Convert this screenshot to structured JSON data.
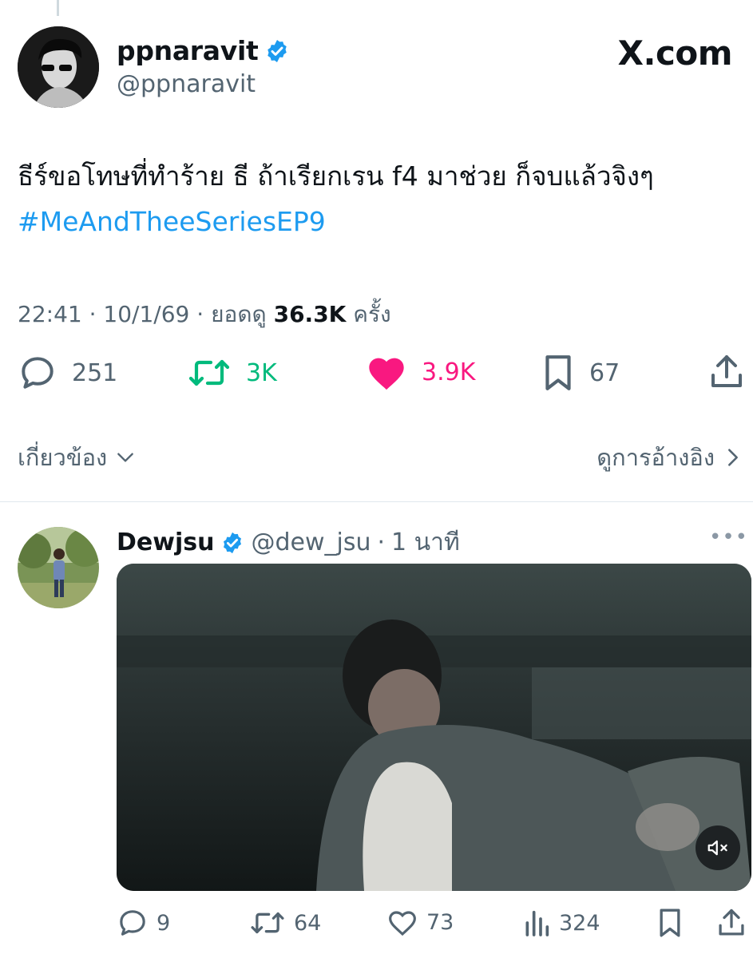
{
  "brand": "X.com",
  "tweet": {
    "display_name": "ppnaravit",
    "handle": "@ppnaravit",
    "text": "ธีร์ขอโทษที่ทำร้าย ธี ถ้าเรียกเรน f4 มาช่วย ก็จบแล้วจิงๆ",
    "hashtag": "#MeAndTheeSeriesEP9",
    "time": "22:41",
    "date": "10/1/69",
    "views_label": "ยอดดู",
    "views_count": "36.3K",
    "views_suffix": "ครั้ง",
    "replies": "251",
    "retweets": "3K",
    "likes": "3.9K",
    "bookmarks": "67",
    "related_label": "เกี่ยวข้อง",
    "quotes_label": "ดูการอ้างอิง",
    "colors": {
      "retweet": "#00ba7c",
      "like": "#f91880",
      "link": "#1d9bf0",
      "verified": "#1d9bf0"
    }
  },
  "reply": {
    "display_name": "Dewjsu",
    "handle": "@dew_jsu",
    "time": "1 นาที",
    "replies": "9",
    "retweets": "64",
    "likes": "73",
    "views": "324"
  }
}
